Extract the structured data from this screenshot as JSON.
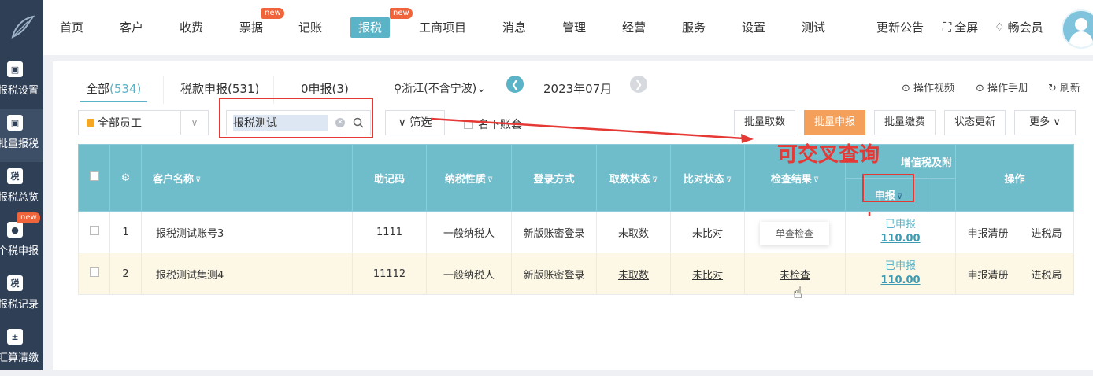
{
  "sidebar": {
    "items": [
      {
        "label": "报税设置",
        "icon": "monitor-icon"
      },
      {
        "label": "批量报税",
        "icon": "monitor-icon"
      },
      {
        "label": "报税总览",
        "icon": "tax-icon"
      },
      {
        "label": "个税申报",
        "icon": "person-tax-icon",
        "badge": "new"
      },
      {
        "label": "报税记录",
        "icon": "tax-record-icon"
      },
      {
        "label": "汇算清缴",
        "icon": "calculator-icon"
      }
    ]
  },
  "topnav": {
    "items": [
      {
        "label": "首页"
      },
      {
        "label": "客户"
      },
      {
        "label": "收费"
      },
      {
        "label": "票据",
        "badge": "new"
      },
      {
        "label": "记账"
      },
      {
        "label": "报税",
        "badge": "new",
        "active": true
      },
      {
        "label": "工商项目"
      },
      {
        "label": "消息"
      },
      {
        "label": "管理"
      },
      {
        "label": "经营"
      },
      {
        "label": "服务"
      },
      {
        "label": "设置"
      },
      {
        "label": "测试"
      }
    ],
    "announcement": "更新公告",
    "fullscreen": "全屏",
    "member": "畅会员"
  },
  "tabs": [
    {
      "label": "全部",
      "count": "(534)"
    },
    {
      "label": "税款申报",
      "count": "(531)"
    },
    {
      "label": "0申报",
      "count": "(3)"
    }
  ],
  "region": "浙江(不含宁波)",
  "period": "2023年07月",
  "tools": {
    "video": "操作视频",
    "manual": "操作手册",
    "refresh": "刷新"
  },
  "filters": {
    "staff": "全部员工",
    "search_value": "报税测试",
    "filter_label": "筛选",
    "checkbox_label": "名下账套"
  },
  "buttons": {
    "batch_fetch": "批量取数",
    "batch_declare": "批量申报",
    "batch_pay": "批量缴费",
    "status_update": "状态更新",
    "more": "更多"
  },
  "table": {
    "headers": {
      "customer": "客户名称",
      "code": "助记码",
      "tax_type": "纳税性质",
      "login": "登录方式",
      "fetch_status": "取数状态",
      "compare_status": "比对状态",
      "check_result": "检查结果",
      "vat_group": "增值税及附",
      "declare": "申报",
      "ops": "操作"
    },
    "rows": [
      {
        "no": "1",
        "customer": "报税测试账号3",
        "code": "1111",
        "tax_type": "一般纳税人",
        "login": "新版账密登录",
        "fetch": "未取数",
        "compare": "未比对",
        "check": "",
        "declare_status": "已申报",
        "declare_amount": "110.00",
        "op1": "申报清册",
        "op2": "进税局"
      },
      {
        "no": "2",
        "customer": "报税测试集测4",
        "code": "11112",
        "tax_type": "一般纳税人",
        "login": "新版账密登录",
        "fetch": "未取数",
        "compare": "未比对",
        "check": "未检查",
        "declare_status": "已申报",
        "declare_amount": "110.00",
        "op1": "申报清册",
        "op2": "进税局"
      }
    ]
  },
  "tooltip": "单查检查",
  "annotation": "可交叉查询",
  "colors": {
    "accent": "#5bb3c7",
    "header": "#6fbccb",
    "primary_button": "#f5a05a",
    "sidebar": "#2f3f55",
    "annotation": "#e53935"
  }
}
